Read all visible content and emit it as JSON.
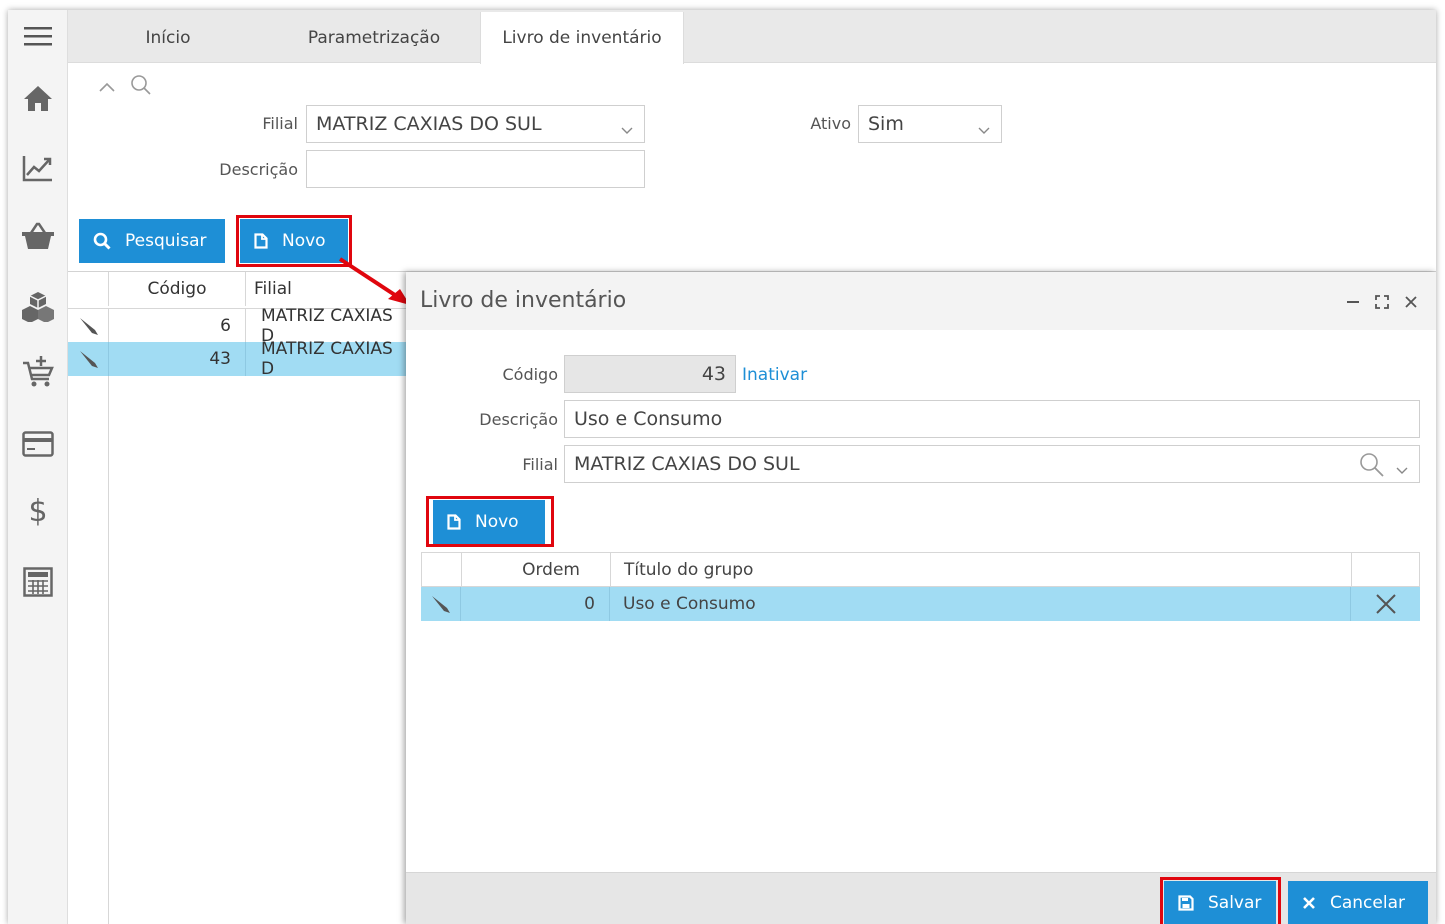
{
  "tabs": [
    {
      "label": "Início"
    },
    {
      "label": "Parametrização"
    },
    {
      "label": "Livro de inventário"
    }
  ],
  "rail": [
    "menu-icon",
    "home-icon",
    "chart-icon",
    "basket-icon",
    "boxes-icon",
    "cart-add-icon",
    "card-icon",
    "dollar-icon",
    "calculator-icon"
  ],
  "search": {
    "filial_label": "Filial",
    "filial_value": "MATRIZ CAXIAS DO SUL",
    "ativo_label": "Ativo",
    "ativo_value": "Sim",
    "descricao_label": "Descrição",
    "descricao_value": "",
    "pesquisar_label": "Pesquisar",
    "novo_label": "Novo"
  },
  "grid": {
    "columns": [
      "Código",
      "Filial"
    ],
    "rows": [
      {
        "codigo": "6",
        "filial": "MATRIZ CAXIAS D"
      },
      {
        "codigo": "43",
        "filial": "MATRIZ CAXIAS D"
      }
    ]
  },
  "dialog": {
    "title": "Livro de inventário",
    "codigo_label": "Código",
    "codigo_value": "43",
    "inativar_label": "Inativar",
    "descricao_label": "Descrição",
    "descricao_value": "Uso e Consumo",
    "filial_label": "Filial",
    "filial_value": "MATRIZ CAXIAS DO SUL",
    "novo_label": "Novo",
    "columns": [
      "Ordem",
      "Título do grupo"
    ],
    "rows": [
      {
        "ordem": "0",
        "titulo": "Uso e Consumo"
      }
    ],
    "salvar_label": "Salvar",
    "cancelar_label": "Cancelar"
  },
  "colors": {
    "accent": "#1e8fd6",
    "highlight_row": "#a1dcf3",
    "annotation_red": "#e0060e"
  }
}
